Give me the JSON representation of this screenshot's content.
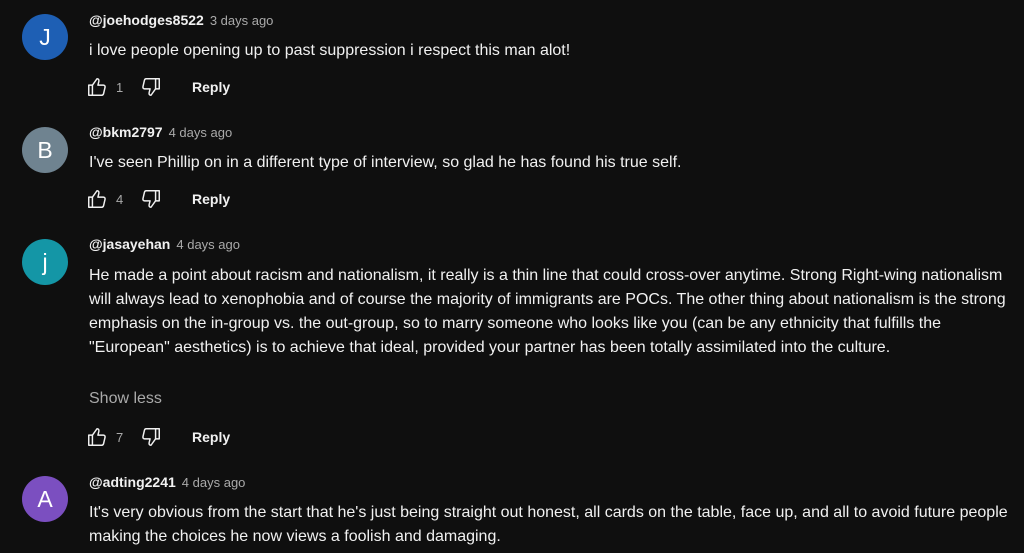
{
  "comments": [
    {
      "avatar_letter": "J",
      "avatar_color": "#1e5fb4",
      "author": "@joehodges8522",
      "time": "3 days ago",
      "text": "i love people opening up to past suppression i respect this man alot!",
      "likes": "1",
      "reply_label": "Reply"
    },
    {
      "avatar_letter": "B",
      "avatar_color": "#6f8390",
      "author": "@bkm2797",
      "time": "4 days ago",
      "text": "I've seen Phillip on in a different type of interview, so glad he has found his true self.",
      "likes": "4",
      "reply_label": "Reply"
    },
    {
      "avatar_letter": "j",
      "avatar_color": "#1496a6",
      "author": "@jasayehan",
      "time": "4 days ago",
      "text": "He made a point about racism and nationalism, it really is a thin line that could cross-over anytime. Strong Right-wing nationalism will always lead to xenophobia and of course the majority of immigrants are POCs. The other thing about nationalism is the strong emphasis on the in-group vs. the out-group, so to marry someone who looks like you (can be any ethnicity that fulfills the \"European\" aesthetics) is to achieve that ideal, provided your partner has been totally assimilated into the culture.",
      "show_less": "Show less",
      "likes": "7",
      "reply_label": "Reply"
    },
    {
      "avatar_letter": "A",
      "avatar_color": "#7b4fc0",
      "author": "@adting2241",
      "time": "4 days ago",
      "text": "It's very obvious from the start that he's just being straight out honest, all cards on the table, face up, and all to avoid future people making the choices he now views a foolish and damaging."
    }
  ]
}
